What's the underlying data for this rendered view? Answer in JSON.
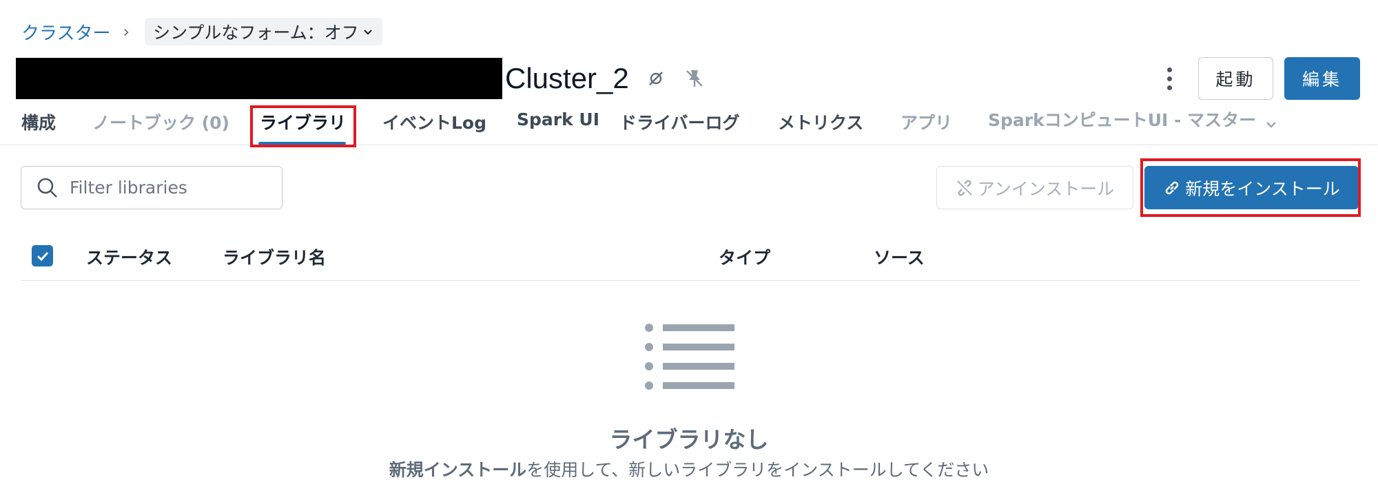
{
  "breadcrumb": {
    "link": "クラスター",
    "separator": "›",
    "form_toggle": "シンプルなフォーム：オフ"
  },
  "header": {
    "cluster_name": "Cluster_2",
    "actions": {
      "start_label": "起動",
      "edit_label": "編集"
    }
  },
  "tabs": [
    {
      "label": "構成"
    },
    {
      "label": "ノートブック (0)"
    },
    {
      "label": "ライブラリ"
    },
    {
      "label": "イベントLog"
    },
    {
      "label": "Spark UI"
    },
    {
      "label": "ドライバーログ"
    },
    {
      "label": "メトリクス"
    },
    {
      "label": "アプリ"
    },
    {
      "label": "SparkコンピュートUI - マスター"
    }
  ],
  "toolbar": {
    "search_placeholder": "Filter libraries",
    "uninstall_label": "アンインストール",
    "install_new_label": "新規をインストール"
  },
  "table": {
    "columns": [
      "ステータス",
      "ライブラリ名",
      "タイプ",
      "ソース"
    ]
  },
  "empty_state": {
    "title": "ライブラリなし",
    "description_bold": "新規インストール",
    "description_rest": "を使用して、新しいライブラリをインストールしてください"
  },
  "colors": {
    "accent": "#2272b4",
    "highlight": "#e01a22",
    "muted": "#9aa5b1"
  }
}
